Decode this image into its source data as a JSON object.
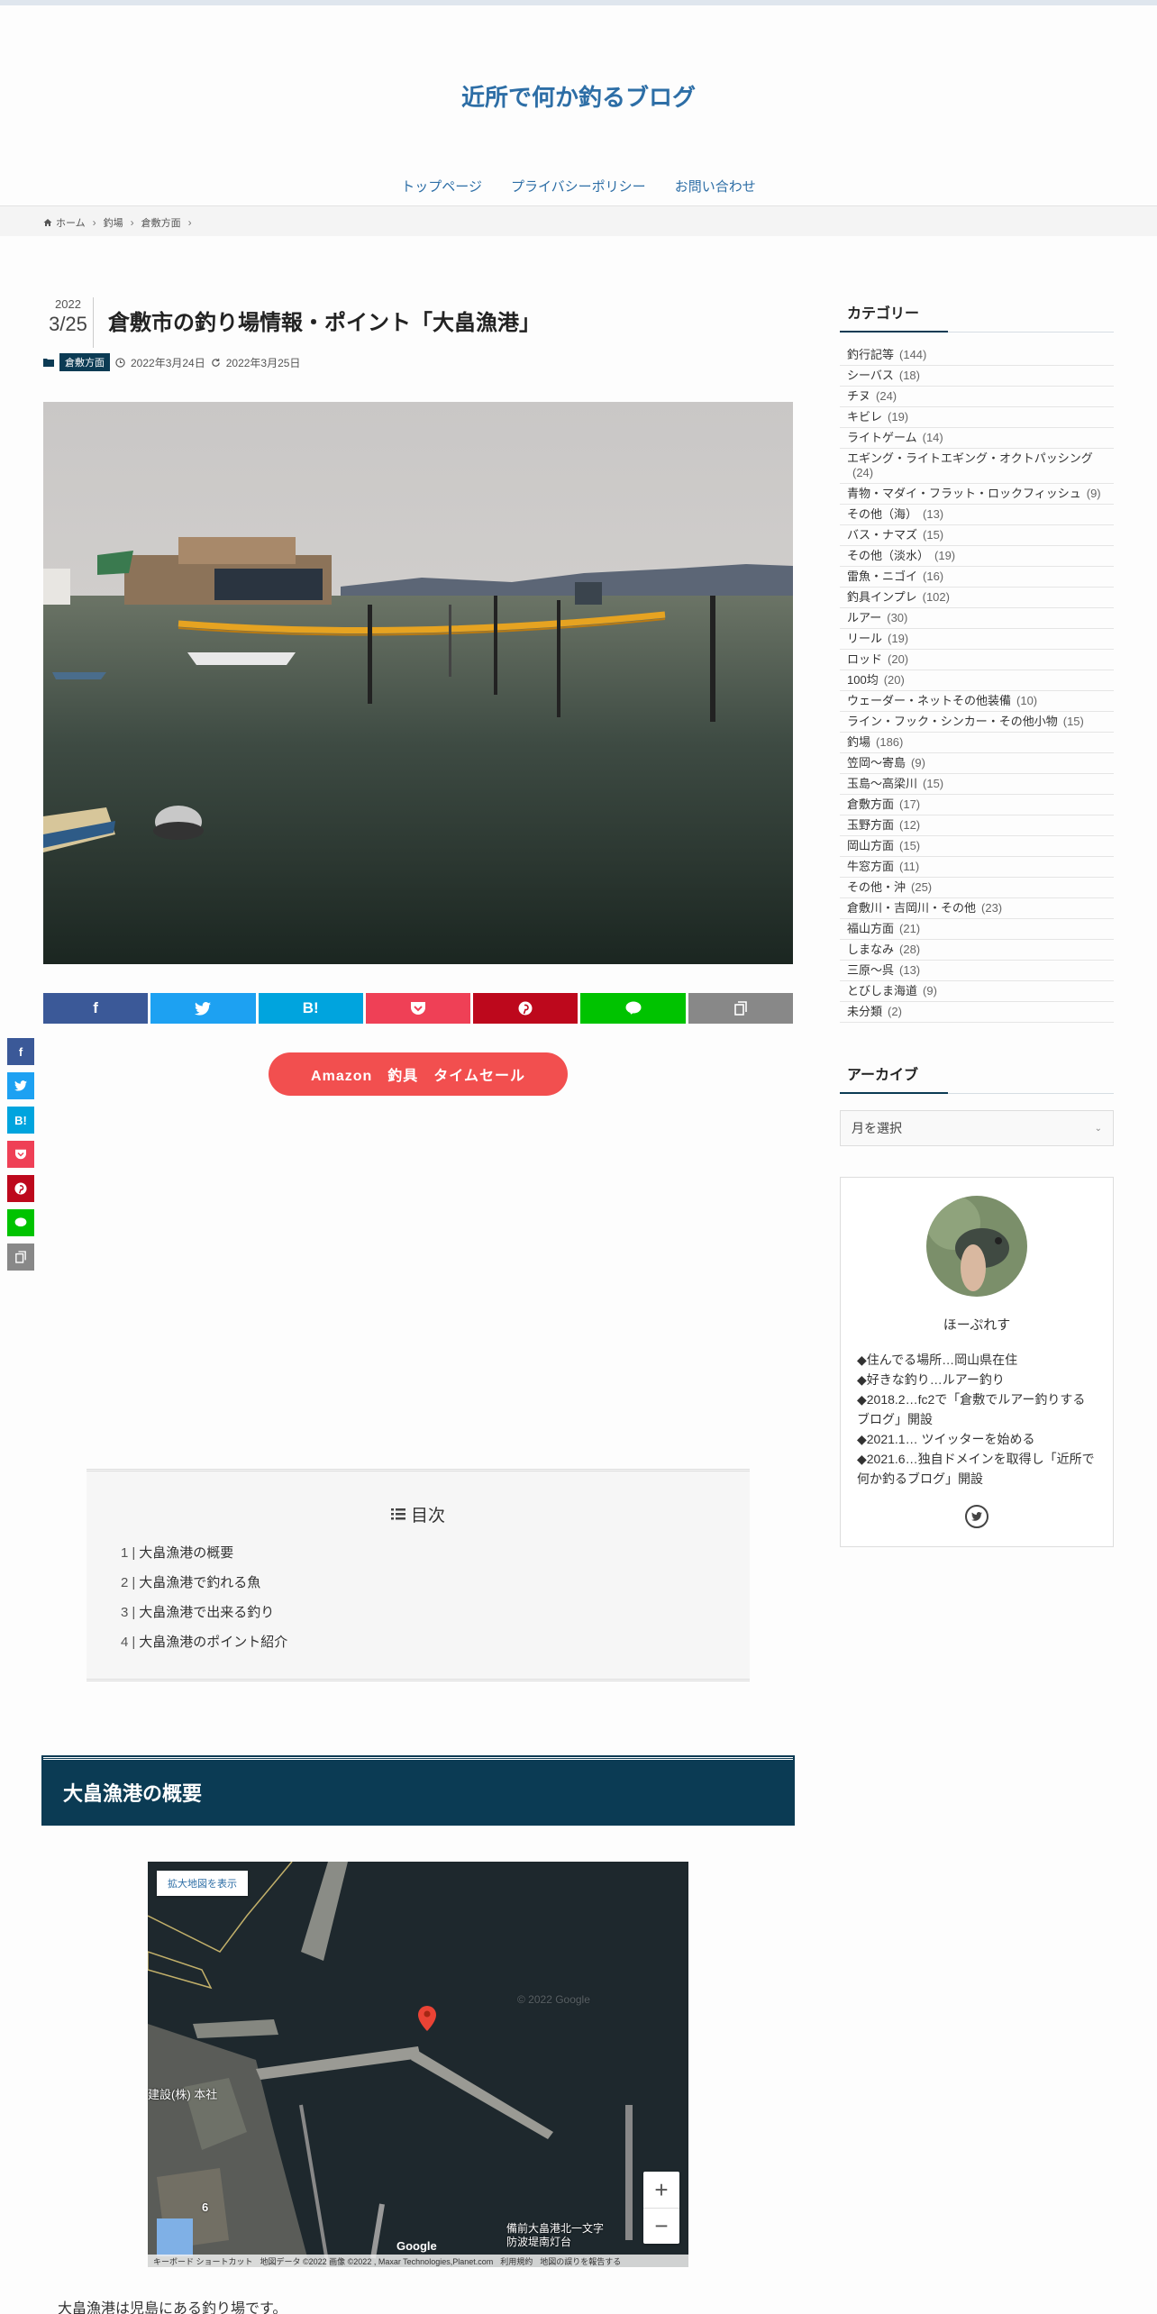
{
  "site": {
    "title": "近所で何か釣るブログ",
    "nav": [
      "トップページ",
      "プライバシーポリシー",
      "お問い合わせ"
    ]
  },
  "breadcrumb": [
    "ホーム",
    "釣場",
    "倉敷方面"
  ],
  "post": {
    "year": "2022",
    "month_day": "3/25",
    "title": "倉敷市の釣り場情報・ポイント「大畠漁港」",
    "category": "倉敷方面",
    "published": "2022年3月24日",
    "updated": "2022年3月25日",
    "amazon_button": "Amazon　釣具　タイムセール",
    "toc_title": "目次",
    "toc": [
      {
        "num": "1",
        "label": "大畠漁港の概要"
      },
      {
        "num": "2",
        "label": "大畠漁港で釣れる魚"
      },
      {
        "num": "3",
        "label": "大畠漁港で出来る釣り"
      },
      {
        "num": "4",
        "label": "大畠漁港のポイント紹介"
      }
    ],
    "h2": "大畠漁港の概要",
    "body_first": "大畠漁港は児島にある釣り場です。"
  },
  "share": {
    "colors": [
      "#3b5998",
      "#1da1f2",
      "#00a4de",
      "#ef4056",
      "#bd081c",
      "#00c300",
      "#888888"
    ],
    "icons": [
      "facebook-icon",
      "twitter-icon",
      "hatena-icon",
      "pocket-icon",
      "pinterest-icon",
      "line-icon",
      "copy-icon"
    ],
    "hatena_label": "B!"
  },
  "map": {
    "expand_label": "拡大地図を表示",
    "label_company": "建設(株) 本社",
    "label_lighthouse": "備前大畠港北一文字\n防波堤南灯台",
    "label_num": "6",
    "watermark": "© 2022 Google",
    "google": "Google",
    "footer": [
      "キーボード ショートカット",
      "地図データ ©2022 画像 ©2022 , Maxar Technologies,Planet.com",
      "利用規約",
      "地図の誤りを報告する"
    ]
  },
  "sidebar": {
    "categories_title": "カテゴリー",
    "categories": [
      {
        "name": "釣行記等",
        "count": "(144)",
        "parent": true
      },
      {
        "name": "シーバス",
        "count": "(18)"
      },
      {
        "name": "チヌ",
        "count": "(24)"
      },
      {
        "name": "キビレ",
        "count": "(19)"
      },
      {
        "name": "ライトゲーム",
        "count": "(14)"
      },
      {
        "name": "エギング・ライトエギング・オクトパッシング",
        "count": "(24)"
      },
      {
        "name": "青物・マダイ・フラット・ロックフィッシュ",
        "count": "(9)"
      },
      {
        "name": "その他（海）",
        "count": "(13)"
      },
      {
        "name": "バス・ナマズ",
        "count": "(15)"
      },
      {
        "name": "その他（淡水）",
        "count": "(19)"
      },
      {
        "name": "雷魚・ニゴイ",
        "count": "(16)"
      },
      {
        "name": "釣具インプレ",
        "count": "(102)",
        "parent": true
      },
      {
        "name": "ルアー",
        "count": "(30)"
      },
      {
        "name": "リール",
        "count": "(19)"
      },
      {
        "name": "ロッド",
        "count": "(20)"
      },
      {
        "name": "100均",
        "count": "(20)"
      },
      {
        "name": "ウェーダー・ネットその他装備",
        "count": "(10)"
      },
      {
        "name": "ライン・フック・シンカー・その他小物",
        "count": "(15)"
      },
      {
        "name": "釣場",
        "count": "(186)",
        "parent": true
      },
      {
        "name": "笠岡～寄島",
        "count": "(9)"
      },
      {
        "name": "玉島～高梁川",
        "count": "(15)"
      },
      {
        "name": "倉敷方面",
        "count": "(17)"
      },
      {
        "name": "玉野方面",
        "count": "(12)"
      },
      {
        "name": "岡山方面",
        "count": "(15)"
      },
      {
        "name": "牛窓方面",
        "count": "(11)"
      },
      {
        "name": "その他・沖",
        "count": "(25)"
      },
      {
        "name": "倉敷川・吉岡川・その他",
        "count": "(23)"
      },
      {
        "name": "福山方面",
        "count": "(21)"
      },
      {
        "name": "しまなみ",
        "count": "(28)"
      },
      {
        "name": "三原～呉",
        "count": "(13)"
      },
      {
        "name": "とびしま海道",
        "count": "(9)"
      },
      {
        "name": "未分類",
        "count": "(2)",
        "parent": true
      }
    ],
    "archive_title": "アーカイブ",
    "archive_select": "月を選択",
    "profile": {
      "name": "ほーぷれす",
      "lines": [
        "◆住んでる場所…岡山県在住",
        "◆好きな釣り…ルアー釣り",
        "◆2018.2…fc2で「倉敷でルアー釣りするブログ」開設",
        "◆2021.1… ツイッターを始める",
        "◆2021.6…独自ドメインを取得し「近所で何か釣るブログ」開設"
      ]
    }
  }
}
